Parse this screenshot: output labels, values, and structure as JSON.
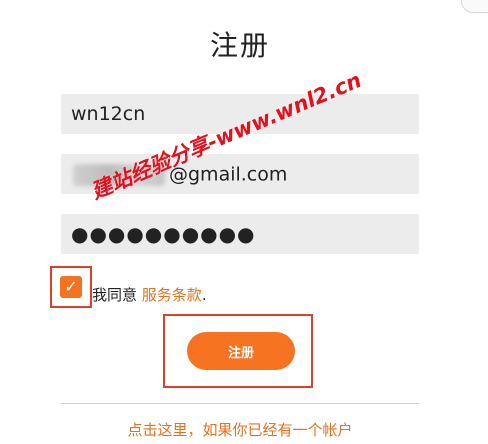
{
  "form": {
    "title": "注册",
    "username_value": "wn12cn",
    "email_value_visible": "@gmail.com",
    "password_value": "●●●●●●●●●●",
    "agree_prefix": "我同意",
    "terms_link": "服务条款",
    "agree_suffix": ".",
    "checkbox_checked": true,
    "submit_label": "注册",
    "login_link": "点击这里，如果你已经有一个帐户"
  },
  "watermark": {
    "text": "建站经验分享-www.wnl2.cn"
  },
  "colors": {
    "accent": "#f57321",
    "link": "#e8701e",
    "highlight_border": "#d9412e",
    "field_bg": "#ececec",
    "watermark": "#e3101e"
  }
}
